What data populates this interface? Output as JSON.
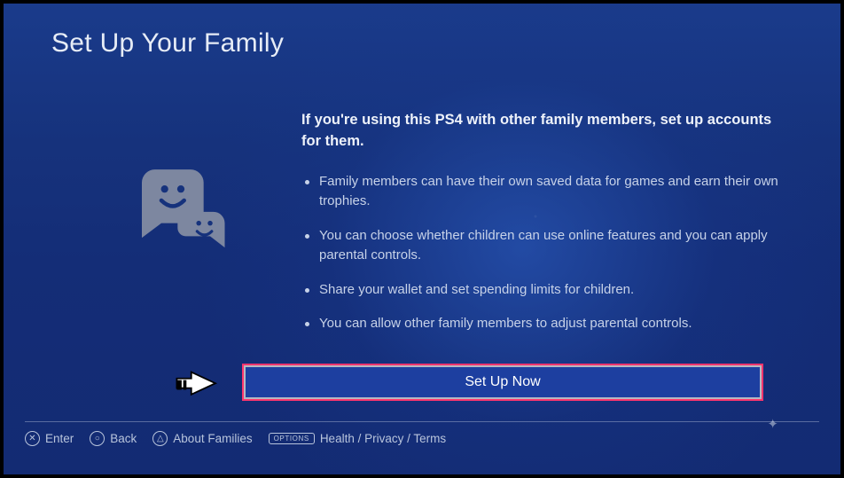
{
  "title": "Set Up Your Family",
  "headline": "If you're using this PS4 with other family members, set up accounts for them.",
  "points": [
    "Family members can have their own saved data for games and earn their own trophies.",
    "You can choose whether children can use online features and you can apply parental controls.",
    "Share your wallet and set spending limits for children.",
    "You can allow other family members to adjust parental controls."
  ],
  "action": {
    "label": "Set Up Now"
  },
  "footer": {
    "enter": "Enter",
    "back": "Back",
    "about": "About Families",
    "options_label": "OPTIONS",
    "legal": "Health / Privacy / Terms"
  }
}
